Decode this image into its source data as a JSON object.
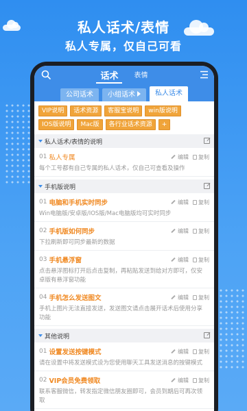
{
  "promo": {
    "title": "私人话术/表情",
    "subtitle": "私人专属，仅自己可看"
  },
  "header": {
    "tabs": [
      {
        "label": "话术",
        "active": true
      },
      {
        "label": "表情",
        "active": false
      }
    ],
    "icons": {
      "left": "search-icon",
      "right": "menu-icon"
    }
  },
  "sub_tabs": [
    {
      "label": "公司话术",
      "active": false
    },
    {
      "label": "小组话术",
      "active": false,
      "has_arrow": true
    },
    {
      "label": "私人话术",
      "active": true
    }
  ],
  "chips": [
    "VIP说明",
    "话术资源",
    "客服宝说明",
    "win版说明",
    "IOS版说明",
    "Mac版",
    "各行业话术资源",
    "+"
  ],
  "sections": [
    {
      "title": "私人话术/表情的说明",
      "items": [
        {
          "num": "01",
          "title": "私人专属",
          "desc": "每个工号都有自己专属的私人话术，仅自己可查看及操作"
        }
      ]
    },
    {
      "title": "手机版说明",
      "items": [
        {
          "num": "01",
          "title": "电脑和手机实时同步",
          "desc": "Win电脑版/安卓版/IOS版/Mac电脑版均可实时同步"
        },
        {
          "num": "02",
          "title": "手机版如何同步",
          "desc": "下拉刷新即可同步最新的数据"
        },
        {
          "num": "03",
          "title": "手机悬浮窗",
          "desc": "点击悬浮图标打开后点击复制，再粘贴发送到给对方即可，仅安卓版有悬浮窗功能"
        },
        {
          "num": "04",
          "title": "手机怎么发送图文",
          "desc": "手机上图片无法直接发送，发送图文请点击展开话术后使用分享功能"
        }
      ]
    },
    {
      "title": "其他说明",
      "items": [
        {
          "num": "01",
          "title": "设置发送按键模式",
          "desc": "请在设置中将发送模式设为您使用聊天工具发送消息的按键模式"
        },
        {
          "num": "02",
          "title": "VIP会员免费领取",
          "desc": "联系客服微信，转发指定微信朋友圈即可，会员到期后可再次领取"
        }
      ]
    }
  ],
  "actions": {
    "edit": "编辑",
    "copy": "复制"
  },
  "colors": {
    "primary": "#3e8de8",
    "accent": "#f08a24",
    "chip": "#f0a43a"
  }
}
